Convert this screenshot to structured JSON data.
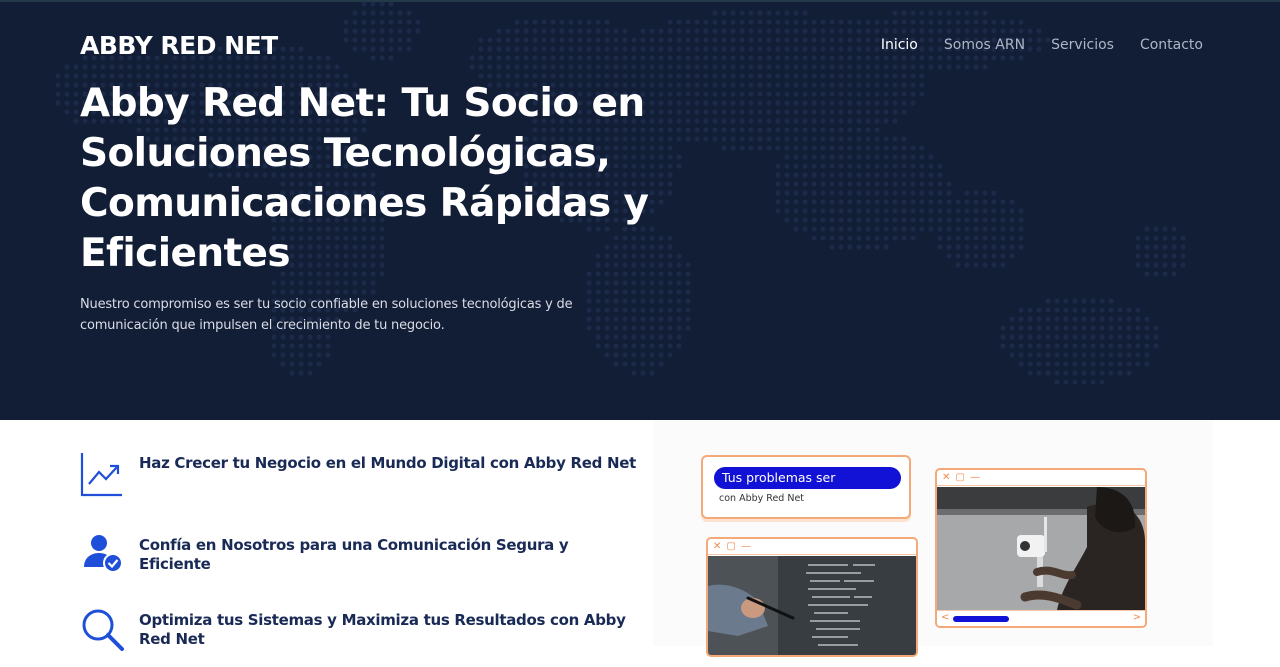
{
  "brand": "ABBY RED NET",
  "nav": [
    "Inicio",
    "Somos ARN",
    "Servicios",
    "Contacto"
  ],
  "hero": {
    "title": "Abby Red Net: Tu Socio en Soluciones Tecnológicas, Comunicaciones Rápidas y Eficientes",
    "lead": "Nuestro compromiso es ser tu socio confiable en soluciones tecnológicas y de comunicación que impulsen el crecimiento de tu negocio."
  },
  "features": [
    {
      "text": "Haz Crecer tu Negocio en el Mundo Digital con Abby Red Net",
      "icon": "growth-chart-icon"
    },
    {
      "text": "Confía en Nosotros para una Comunicación Segura y Eficiente",
      "icon": "verified-user-icon"
    },
    {
      "text": "Optimiza tus Sistemas y Maximiza tus Resultados con Abby Red Net",
      "icon": "magnifier-icon"
    }
  ],
  "illustration": {
    "chat_bubble": "Tus problemas ser",
    "chat_sub": "con Abby Red Net",
    "window_controls": "✕ ▢ —"
  },
  "colors": {
    "hero_bg": "#121d36",
    "heading_text": "#1a2a56",
    "accent_blue": "#1212d6",
    "accent_orange": "#f5a978"
  }
}
